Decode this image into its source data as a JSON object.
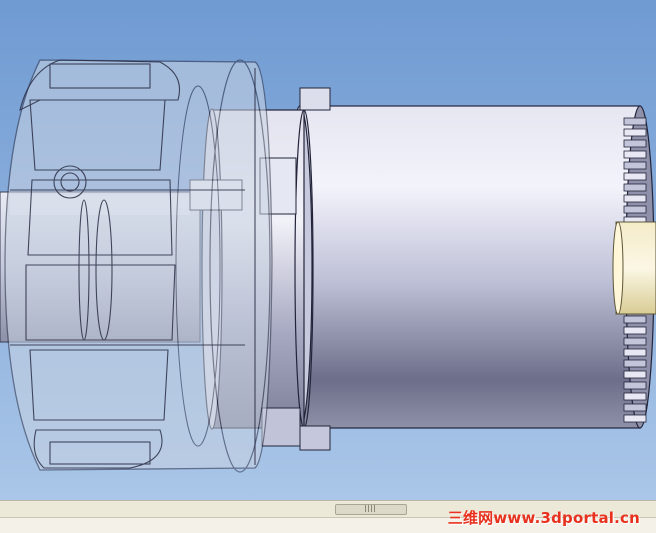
{
  "window": {
    "type": "3d-cad-viewport",
    "model": "shaft with splined hub and transparent ring gear carrier",
    "background_color": "#7ea5d5",
    "hub_color": "#b0b2cc",
    "shaft_tip_color": "#efe3b5",
    "transparent_part_color": "#c9d3e2"
  },
  "scrollbar": {
    "orientation": "horizontal",
    "thumb_icon": "grip-icon"
  },
  "watermark": {
    "text": "三维网www.3dportal.cn",
    "color": "#e8321f"
  }
}
